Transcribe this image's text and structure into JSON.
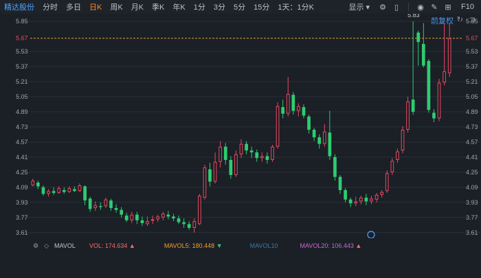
{
  "toolbar": {
    "stock_name": "精达股份",
    "tabs": [
      "分时",
      "多日",
      "日K",
      "周K",
      "月K",
      "季K",
      "年K",
      "1分",
      "3分",
      "5分",
      "15分",
      "1天：1分K"
    ],
    "active_tab": "日K",
    "display_label": "显示",
    "f10": "F10"
  },
  "restore_label": "前复权",
  "price_current": "5.67",
  "vol_indicator": {
    "name": "MAVOL",
    "vol": "VOL: 174.634",
    "mavol5": "MAVOL5: 180.448",
    "mavol10": "MAVOL10",
    "mavol20": "MAVOL20: 106.443"
  },
  "colors": {
    "up": "#e84a5f",
    "down": "#2ecc71",
    "bg": "#1b1f26",
    "grid": "#2a3038",
    "axis_text": "#9aa3ad",
    "price_line": "#e0a23a",
    "current_label": "#e84a5f",
    "vol_label": "#ff6b6b",
    "mavol5_label": "#f0a030",
    "mavol10_label": "#3a7ca5",
    "mavol20_label": "#c86bd6"
  },
  "chart_data": {
    "type": "candlestick",
    "yticks": [
      5.85,
      5.67,
      5.53,
      5.37,
      5.21,
      5.05,
      4.89,
      4.73,
      4.57,
      4.41,
      4.25,
      4.09,
      3.93,
      3.77,
      3.61
    ],
    "ylim": [
      3.55,
      5.93
    ],
    "annotations": [
      {
        "label": "5.83"
      },
      {
        "label": "3.61"
      }
    ],
    "candles": [
      [
        4.11,
        4.16,
        4.18,
        4.1
      ],
      [
        4.14,
        4.1,
        4.16,
        4.07
      ],
      [
        4.09,
        4.02,
        4.11,
        4.0
      ],
      [
        4.02,
        4.05,
        4.07,
        3.99
      ],
      [
        4.05,
        4.03,
        4.09,
        4.01
      ],
      [
        4.03,
        4.08,
        4.1,
        4.02
      ],
      [
        4.06,
        4.04,
        4.09,
        4.02
      ],
      [
        4.04,
        4.08,
        4.1,
        4.03
      ],
      [
        4.07,
        4.05,
        4.1,
        4.04
      ],
      [
        4.05,
        4.11,
        4.13,
        4.04
      ],
      [
        4.1,
        3.95,
        4.11,
        3.9
      ],
      [
        3.97,
        3.86,
        3.99,
        3.83
      ],
      [
        3.87,
        3.9,
        3.94,
        3.84
      ],
      [
        3.89,
        3.88,
        3.93,
        3.85
      ],
      [
        3.89,
        3.96,
        3.98,
        3.87
      ],
      [
        3.95,
        3.87,
        3.97,
        3.84
      ],
      [
        3.87,
        3.85,
        3.91,
        3.82
      ],
      [
        3.85,
        3.8,
        3.88,
        3.77
      ],
      [
        3.79,
        3.74,
        3.82,
        3.72
      ],
      [
        3.74,
        3.8,
        3.83,
        3.71
      ],
      [
        3.8,
        3.74,
        3.83,
        3.7
      ],
      [
        3.74,
        3.71,
        3.78,
        3.68
      ],
      [
        3.7,
        3.73,
        3.78,
        3.68
      ],
      [
        3.74,
        3.75,
        3.79,
        3.7
      ],
      [
        3.75,
        3.78,
        3.8,
        3.72
      ],
      [
        3.77,
        3.81,
        3.83,
        3.74
      ],
      [
        3.8,
        3.78,
        3.84,
        3.75
      ],
      [
        3.78,
        3.76,
        3.81,
        3.73
      ],
      [
        3.76,
        3.72,
        3.79,
        3.7
      ],
      [
        3.72,
        3.7,
        3.76,
        3.66
      ],
      [
        3.7,
        3.66,
        3.73,
        3.64
      ],
      [
        3.66,
        3.73,
        3.76,
        3.61
      ],
      [
        3.7,
        4.0,
        4.02,
        3.69
      ],
      [
        3.98,
        4.3,
        4.33,
        3.96
      ],
      [
        4.28,
        4.15,
        4.35,
        4.1
      ],
      [
        4.15,
        4.36,
        4.46,
        4.13
      ],
      [
        4.36,
        4.52,
        4.58,
        4.3
      ],
      [
        4.52,
        4.38,
        4.56,
        4.33
      ],
      [
        4.38,
        4.22,
        4.42,
        4.18
      ],
      [
        4.22,
        4.44,
        4.48,
        4.2
      ],
      [
        4.44,
        4.55,
        4.6,
        4.4
      ],
      [
        4.55,
        4.48,
        4.58,
        4.44
      ],
      [
        4.48,
        4.46,
        4.52,
        4.4
      ],
      [
        4.46,
        4.4,
        4.49,
        4.36
      ],
      [
        4.4,
        4.42,
        4.46,
        4.36
      ],
      [
        4.42,
        4.38,
        4.46,
        4.34
      ],
      [
        4.38,
        4.52,
        4.54,
        4.36
      ],
      [
        4.52,
        4.95,
        4.99,
        4.5
      ],
      [
        4.94,
        4.87,
        5.02,
        4.82
      ],
      [
        4.87,
        5.08,
        5.26,
        4.84
      ],
      [
        5.07,
        4.9,
        5.1,
        4.86
      ],
      [
        4.9,
        4.95,
        4.98,
        4.84
      ],
      [
        4.94,
        4.85,
        4.97,
        4.82
      ],
      [
        4.84,
        4.7,
        4.86,
        4.66
      ],
      [
        4.7,
        4.62,
        4.72,
        4.58
      ],
      [
        4.62,
        4.55,
        4.65,
        4.5
      ],
      [
        4.55,
        4.68,
        4.76,
        4.52
      ],
      [
        4.67,
        4.42,
        4.9,
        4.38
      ],
      [
        4.41,
        4.2,
        4.44,
        4.16
      ],
      [
        4.2,
        4.06,
        4.22,
        4.02
      ],
      [
        4.06,
        3.96,
        4.08,
        3.93
      ],
      [
        3.96,
        3.92,
        3.98,
        3.88
      ],
      [
        3.92,
        3.94,
        3.99,
        3.89
      ],
      [
        3.94,
        3.98,
        4.0,
        3.91
      ],
      [
        3.98,
        3.94,
        4.02,
        3.9
      ],
      [
        3.94,
        3.97,
        4.0,
        3.91
      ],
      [
        3.96,
        4.01,
        4.03,
        3.93
      ],
      [
        4.01,
        4.04,
        4.06,
        3.98
      ],
      [
        4.05,
        4.24,
        4.27,
        4.03
      ],
      [
        4.25,
        4.37,
        4.4,
        4.22
      ],
      [
        4.38,
        4.47,
        4.5,
        4.35
      ],
      [
        4.48,
        4.7,
        4.74,
        4.45
      ],
      [
        4.7,
        5.0,
        5.05,
        4.67
      ],
      [
        5.02,
        4.89,
        5.85,
        4.86
      ],
      [
        5.73,
        5.63,
        5.75,
        5.38
      ],
      [
        5.61,
        5.38,
        5.83,
        5.36
      ],
      [
        5.43,
        4.91,
        5.45,
        4.88
      ],
      [
        4.88,
        4.82,
        4.92,
        4.78
      ],
      [
        4.82,
        5.2,
        5.24,
        4.79
      ],
      [
        5.2,
        5.32,
        5.82,
        5.17
      ],
      [
        5.3,
        5.67,
        5.83,
        5.26
      ]
    ]
  }
}
